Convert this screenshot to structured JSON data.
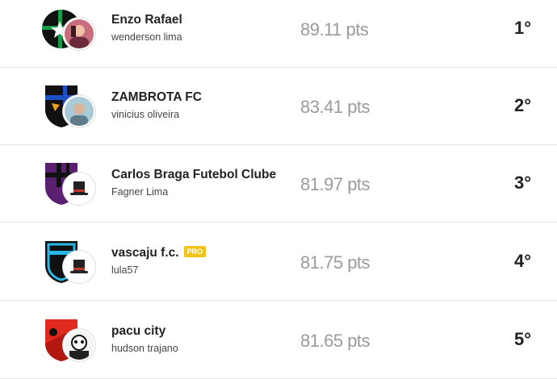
{
  "ranking": [
    {
      "team": "Enzo Rafael",
      "owner": "wenderson lima",
      "points": "89.11",
      "unit": "pts",
      "rank": "1°",
      "crest_icon": "green-black-star-crest",
      "avatar_icon": "user-photo-avatar",
      "pro": null
    },
    {
      "team": "ZAMBROTA FC",
      "owner": "vinicius oliveira",
      "points": "83.41",
      "unit": "pts",
      "rank": "2°",
      "crest_icon": "black-blue-shield-crest",
      "avatar_icon": "user-photo-avatar",
      "pro": null
    },
    {
      "team": "Carlos Braga Futebol Clube",
      "owner": "Fagner Lima",
      "points": "81.97",
      "unit": "pts",
      "rank": "3°",
      "crest_icon": "purple-black-shield-crest",
      "avatar_icon": "top-hat-avatar",
      "pro": null
    },
    {
      "team": "vascaju f.c.",
      "owner": "lula57",
      "points": "81.75",
      "unit": "pts",
      "rank": "4°",
      "crest_icon": "cyan-black-shield-crest",
      "avatar_icon": "top-hat-avatar",
      "pro": "PRO"
    },
    {
      "team": "pacu city",
      "owner": "hudson trajano",
      "points": "81.65",
      "unit": "pts",
      "rank": "5°",
      "crest_icon": "red-white-shield-crest",
      "avatar_icon": "user-photo-avatar",
      "pro": null
    }
  ],
  "colors": {
    "pro_badge": "#f0c419",
    "points_text": "#9a9a9a",
    "divider": "#e6e6e6"
  }
}
